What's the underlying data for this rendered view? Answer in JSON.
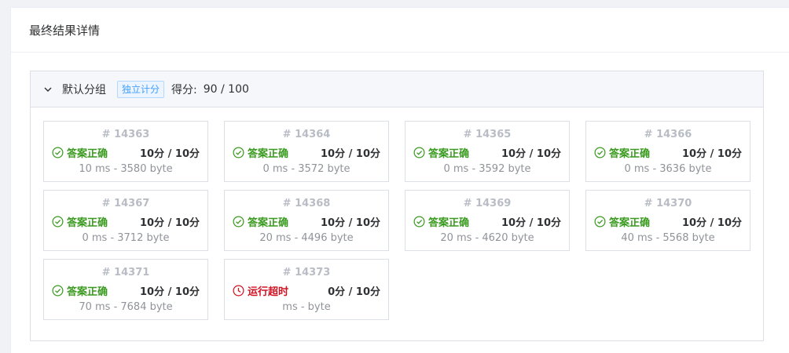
{
  "panel": {
    "title": "最终结果详情"
  },
  "group": {
    "name": "默认分组",
    "tag": "独立计分",
    "score_label": "得分:",
    "score_value": "90 / 100"
  },
  "status_colors": {
    "accepted": "#3a9a1f",
    "tle": "#cf1322"
  },
  "cases": [
    {
      "id": "# 14363",
      "status": "答案正确",
      "status_type": "accepted",
      "icon": "check-circle-icon",
      "score": "10分 / 10分",
      "meta": "10 ms - 3580 byte"
    },
    {
      "id": "# 14364",
      "status": "答案正确",
      "status_type": "accepted",
      "icon": "check-circle-icon",
      "score": "10分 / 10分",
      "meta": "0 ms - 3572 byte"
    },
    {
      "id": "# 14365",
      "status": "答案正确",
      "status_type": "accepted",
      "icon": "check-circle-icon",
      "score": "10分 / 10分",
      "meta": "0 ms - 3592 byte"
    },
    {
      "id": "# 14366",
      "status": "答案正确",
      "status_type": "accepted",
      "icon": "check-circle-icon",
      "score": "10分 / 10分",
      "meta": "0 ms - 3636 byte"
    },
    {
      "id": "# 14367",
      "status": "答案正确",
      "status_type": "accepted",
      "icon": "check-circle-icon",
      "score": "10分 / 10分",
      "meta": "0 ms - 3712 byte"
    },
    {
      "id": "# 14368",
      "status": "答案正确",
      "status_type": "accepted",
      "icon": "check-circle-icon",
      "score": "10分 / 10分",
      "meta": "20 ms - 4496 byte"
    },
    {
      "id": "# 14369",
      "status": "答案正确",
      "status_type": "accepted",
      "icon": "check-circle-icon",
      "score": "10分 / 10分",
      "meta": "20 ms - 4620 byte"
    },
    {
      "id": "# 14370",
      "status": "答案正确",
      "status_type": "accepted",
      "icon": "check-circle-icon",
      "score": "10分 / 10分",
      "meta": "40 ms - 5568 byte"
    },
    {
      "id": "# 14371",
      "status": "答案正确",
      "status_type": "accepted",
      "icon": "check-circle-icon",
      "score": "10分 / 10分",
      "meta": "70 ms - 7684 byte"
    },
    {
      "id": "# 14373",
      "status": "运行超时",
      "status_type": "tle",
      "icon": "clock-icon",
      "score": "0分 / 10分",
      "meta": "ms - byte"
    }
  ]
}
